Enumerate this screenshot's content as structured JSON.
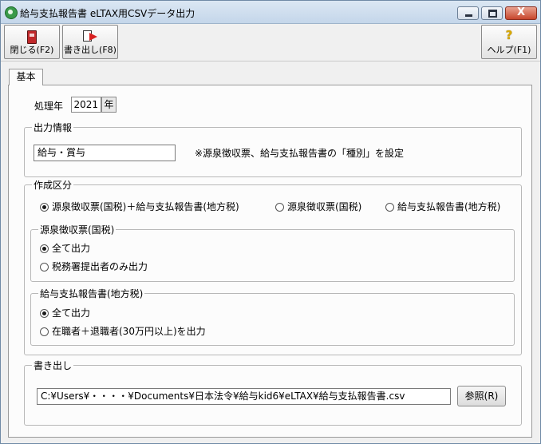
{
  "window": {
    "title": "給与支払報告書 eLTAX用CSVデータ出力",
    "close_glyph": "X"
  },
  "toolbar": {
    "close_label": "閉じる(F2)",
    "export_label": "書き出し(F8)",
    "help_label": "ヘルプ(F1)",
    "help_glyph": "?"
  },
  "tabs": [
    {
      "label": "基本"
    }
  ],
  "year": {
    "label": "処理年",
    "value": "2021",
    "unit": "年"
  },
  "output_info": {
    "legend": "出力情報",
    "value": "給与・賞与",
    "note": "※源泉徴収票、給与支払報告書の「種別」を設定"
  },
  "creation": {
    "legend": "作成区分",
    "options": [
      {
        "label": "源泉徴収票(国税)＋給与支払報告書(地方税)",
        "selected": true
      },
      {
        "label": "源泉徴収票(国税)",
        "selected": false
      },
      {
        "label": "給与支払報告書(地方税)",
        "selected": false
      }
    ]
  },
  "withholding": {
    "legend": "源泉徴収票(国税)",
    "options": [
      {
        "label": "全て出力",
        "selected": true
      },
      {
        "label": "税務署提出者のみ出力",
        "selected": false
      }
    ]
  },
  "salary_report": {
    "legend": "給与支払報告書(地方税)",
    "options": [
      {
        "label": "全て出力",
        "selected": true
      },
      {
        "label": "在職者＋退職者(30万円以上)を出力",
        "selected": false
      }
    ]
  },
  "export": {
    "legend": "書き出し",
    "path": "C:¥Users¥・・・・¥Documents¥日本法令¥給与kid6¥eLTAX¥給与支払報告書.csv",
    "browse_label": "参照(R)"
  }
}
